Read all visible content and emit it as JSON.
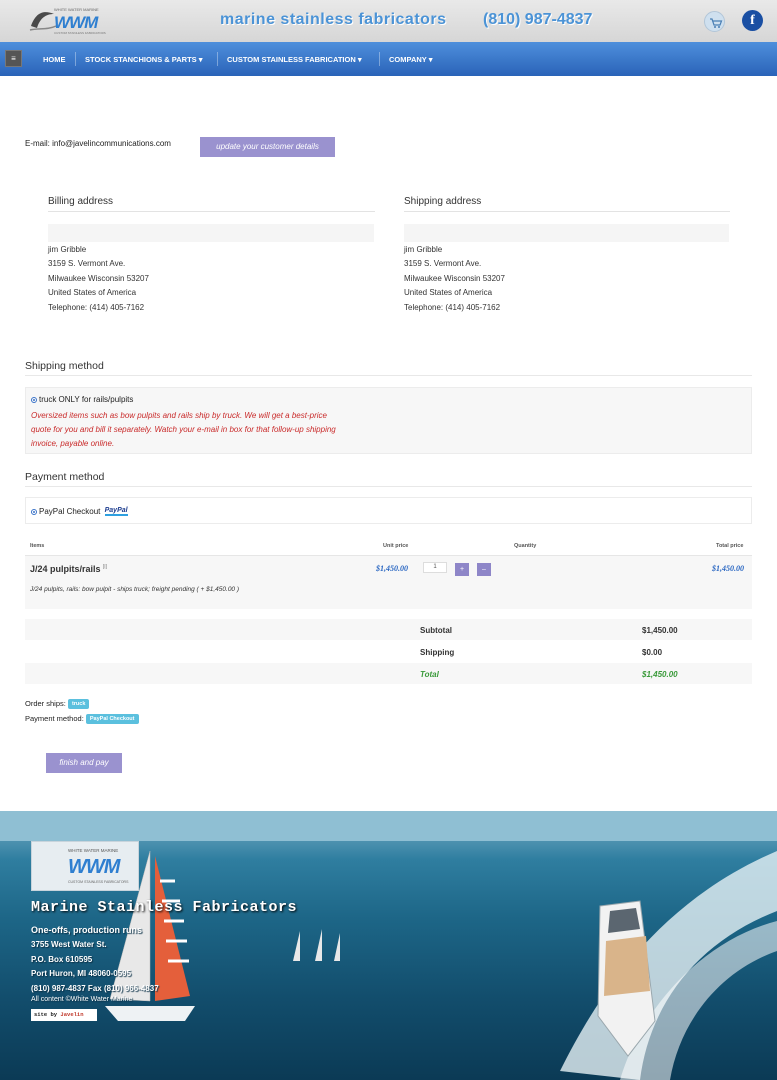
{
  "header": {
    "logo_tag": "WHITE WATER MARINE",
    "logo_text": "WWM",
    "logo_sub": "CUSTOM STAINLESS FABRICATORS",
    "tagline": "marine stainless fabricators",
    "phone": "(810) 987-4837"
  },
  "nav": {
    "toggle": "≡",
    "items": [
      "HOME",
      "STOCK STANCHIONS & PARTS ▾",
      "CUSTOM STAINLESS FABRICATION ▾",
      "COMPANY ▾"
    ]
  },
  "customer": {
    "email": "E-mail: info@javelincommunications.com",
    "update_label": "update your customer details"
  },
  "billing": {
    "title": "Billing address",
    "lines": [
      "jim Gribble",
      "3159 S. Vermont Ave.",
      "Milwaukee Wisconsin 53207",
      "United States of America",
      "Telephone: (414) 405-7162"
    ]
  },
  "shipping_address": {
    "title": "Shipping address",
    "lines": [
      "jim Gribble",
      "3159 S. Vermont Ave.",
      "Milwaukee Wisconsin 53207",
      "United States of America",
      "Telephone: (414) 405-7162"
    ]
  },
  "shipping_method": {
    "title": "Shipping method",
    "option": "truck ONLY for rails/pulpits",
    "note": "Oversized items such as bow pulpits and rails ship by truck. We will get a best-price quote for you and bill it separately. Watch your e-mail in box for that follow-up shipping invoice, payable online."
  },
  "payment_method": {
    "title": "Payment method",
    "option": "PayPal Checkout",
    "badge": "PayPal"
  },
  "cart": {
    "headers": {
      "items": "Items",
      "unit_price": "Unit price",
      "quantity": "Quantity",
      "total_price": "Total price"
    },
    "item": {
      "name": "J/24 pulpits/rails",
      "marker": "[i]",
      "unit_price": "$1,450.00",
      "quantity": "1",
      "plus": "+",
      "minus": "–",
      "total_price": "$1,450.00",
      "description": "J/24 pulpits, rails: bow pulpit - ships truck; freight pending ( + $1,450.00 )"
    },
    "totals": [
      {
        "label": "Subtotal",
        "value": "$1,450.00"
      },
      {
        "label": "Shipping",
        "value": "$0.00"
      },
      {
        "label": "Total",
        "value": "$1,450.00"
      }
    ]
  },
  "summary": {
    "ships_label": "Order ships:",
    "ships_value": "truck",
    "payment_label": "Payment method:",
    "payment_value": "PayPal Checkout"
  },
  "finish_label": "finish and pay",
  "footer": {
    "logo_tag": "WHITE WATER MARINE",
    "logo_text": "WWM",
    "logo_sub": "CUSTOM STAINLESS FABRICATORS",
    "title": "Marine Stainless Fabricators",
    "subtitle": "One-offs, production runs",
    "address1": "3755 West Water St.",
    "address2": "P.O. Box 610595",
    "address3": "Port Huron, MI 48060-0595",
    "phone": "(810) 987-4837 Fax (810) 966-4837",
    "copyright": "All content ©White Water Marine",
    "site_by": "site by",
    "site_by_brand": "Javelin"
  },
  "colors": {
    "nav_blue": "#2a63b8",
    "button_purple": "#9a92cf",
    "note_red": "#c92a2a",
    "price_blue": "#2a67c2",
    "total_green": "#3a9a3a",
    "badge_cyan": "#5bc0de"
  }
}
